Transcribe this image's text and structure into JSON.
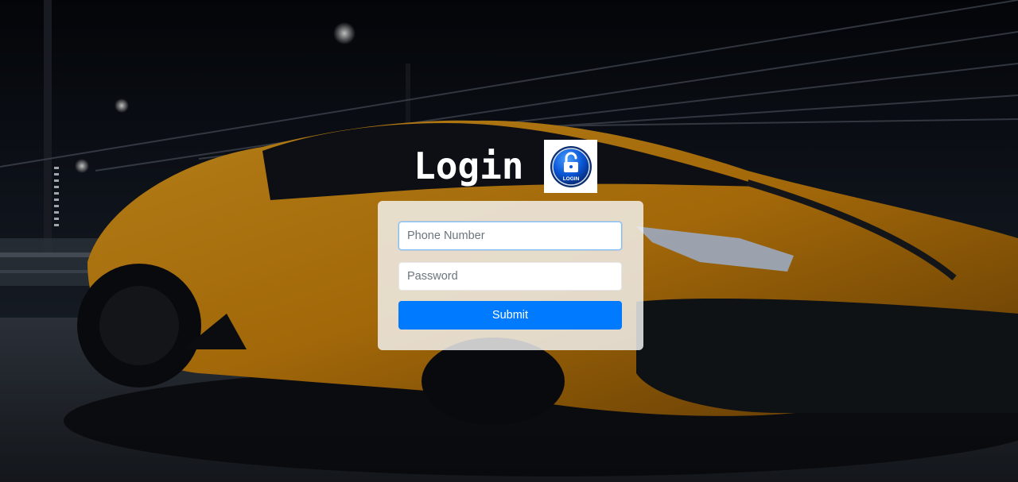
{
  "page": {
    "title": "Login"
  },
  "logo": {
    "icon": "padlock-login-icon",
    "text": "LOGIN"
  },
  "form": {
    "phone_placeholder": "Phone Number",
    "phone_value": "",
    "password_placeholder": "Password",
    "password_value": "",
    "submit_label": "Submit"
  },
  "colors": {
    "accent": "#007bff",
    "car": "#e89a12",
    "card": "#f5f5f5",
    "title": "#ffffff"
  }
}
